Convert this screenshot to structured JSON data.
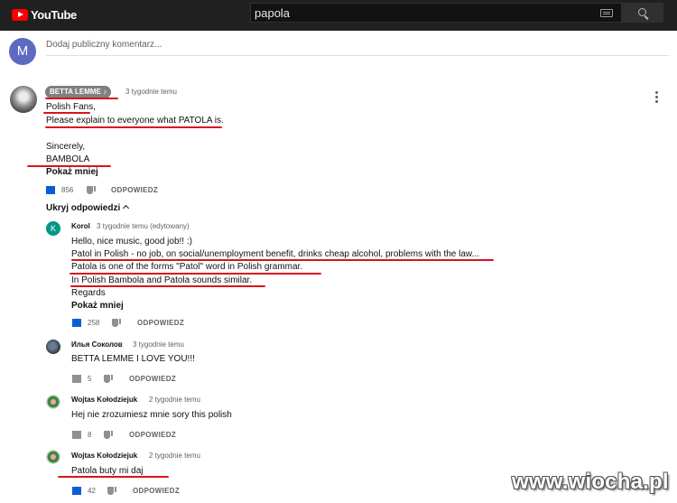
{
  "app": {
    "brand": "YouTube"
  },
  "search": {
    "query": "papola"
  },
  "composer": {
    "avatar_letter": "M",
    "placeholder": "Dodaj publiczny komentarz..."
  },
  "comment": {
    "author": "BETTA LEMME",
    "author_icon": "music-note-icon",
    "time": "3 tygodnie temu",
    "lines": [
      "Polish Fans,",
      "Please explain to everyone what PATOLA is.",
      "Sincerely,",
      "BAMBOLA"
    ],
    "show_less": "Pokaż mniej",
    "likes": "856",
    "reply_label": "ODPOWIEDZ",
    "hide_replies": "Ukryj odpowiedzi"
  },
  "replies": [
    {
      "avatar_letter": "K",
      "author": "Korol",
      "time": "3 tygodnie temu (edytowany)",
      "lines": [
        "Hello, nice music, good job!! :)",
        "Patol in Polish - no job, on social/unemployment benefit, drinks cheap alcohol, problems with the law...",
        "Patola is one of the forms \"Patol\" word in Polish grammar.",
        "In Polish Bambola and Patola sounds similar.",
        "Regards"
      ],
      "show_less": "Pokaż mniej",
      "likes": "258",
      "reply_label": "ODPOWIEDZ"
    },
    {
      "author": "Илья Соколов",
      "time": "3 tygodnie temu",
      "lines": [
        "BETTA LEMME I LOVE YOU!!!"
      ],
      "likes": "5",
      "reply_label": "ODPOWIEDZ"
    },
    {
      "author": "Wojtas Kołodziejuk",
      "time": "2 tygodnie temu",
      "lines": [
        "Hej nie zrozumiesz mnie sory this polish"
      ],
      "likes": "8",
      "reply_label": "ODPOWIEDZ"
    },
    {
      "author": "Wojtas Kołodziejuk",
      "time": "2 tygodnie temu",
      "lines": [
        "Patola buty mi daj"
      ],
      "likes": "42",
      "reply_label": "ODPOWIEDZ"
    }
  ],
  "watermark": "www.wiocha.pl",
  "colors": {
    "underline": "#d8141e",
    "like_active": "#065fd4",
    "topbar": "#202020",
    "brand_red": "#ff0000"
  }
}
